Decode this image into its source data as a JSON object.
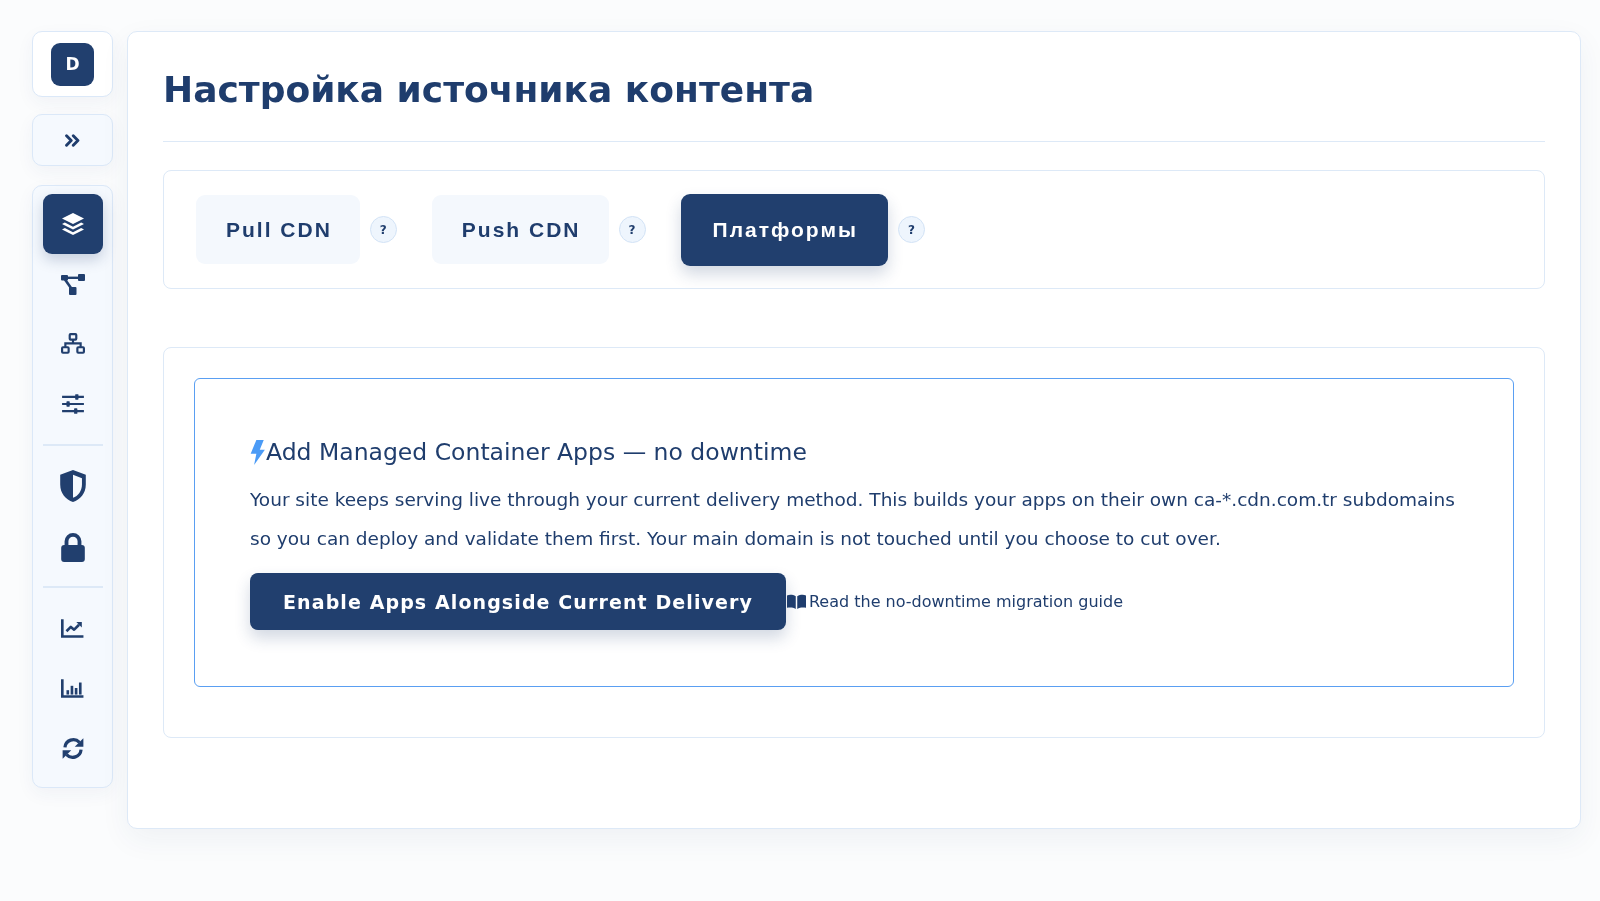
{
  "sidebar": {
    "logo": "D",
    "groups": [
      {
        "items": [
          {
            "selected": true
          },
          {
            "selected": false
          },
          {
            "selected": false
          },
          {
            "selected": false
          }
        ]
      },
      {
        "items": [
          {
            "selected": false
          },
          {
            "selected": false
          }
        ]
      },
      {
        "items": [
          {
            "selected": false
          },
          {
            "selected": false
          },
          {
            "selected": false
          }
        ]
      }
    ]
  },
  "page": {
    "title": "Настройка источника контента"
  },
  "tabs": [
    {
      "label": "Pull CDN",
      "help": "?",
      "selected": false
    },
    {
      "label": "Push CDN",
      "help": "?",
      "selected": false
    },
    {
      "label": "Платформы",
      "help": "?",
      "selected": true
    }
  ],
  "callout": {
    "title": "Add Managed Container Apps — no downtime",
    "text": "Your site keeps serving live through your current delivery method. This builds your apps on their own ca-*.cdn.com.tr subdomains so you can deploy and validate them first. Your main domain is not touched until you choose to cut over.",
    "button": "Enable Apps Alongside Current Delivery",
    "link": "Read the no-downtime migration guide"
  }
}
